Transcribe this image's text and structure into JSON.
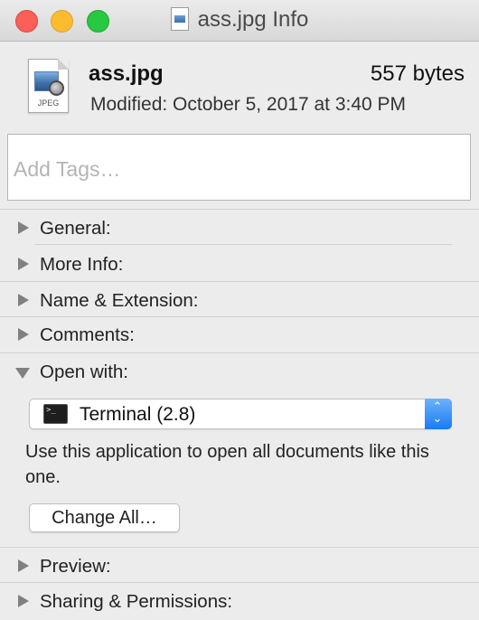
{
  "window": {
    "title": "ass.jpg Info",
    "traffic_lights": {
      "close": "#fc5f57",
      "minimize": "#fdbc2e",
      "zoom": "#28c840"
    }
  },
  "file": {
    "name": "ass.jpg",
    "size": "557 bytes",
    "modified": "Modified: October 5, 2017 at 3:40 PM",
    "icon_label": "JPEG"
  },
  "tags": {
    "placeholder": "Add Tags…",
    "value": ""
  },
  "sections": {
    "general": "General:",
    "more_info": "More Info:",
    "name_extension": "Name & Extension:",
    "comments": "Comments:",
    "open_with": "Open with:",
    "preview": "Preview:",
    "sharing": "Sharing & Permissions:"
  },
  "open_with": {
    "selected_app": "Terminal (2.8)",
    "app_icon": "terminal-icon",
    "description": "Use this application to open all documents like this one.",
    "change_all_label": "Change All…"
  },
  "colors": {
    "accent": "#1a7bf4",
    "disclosure": "#808080"
  }
}
